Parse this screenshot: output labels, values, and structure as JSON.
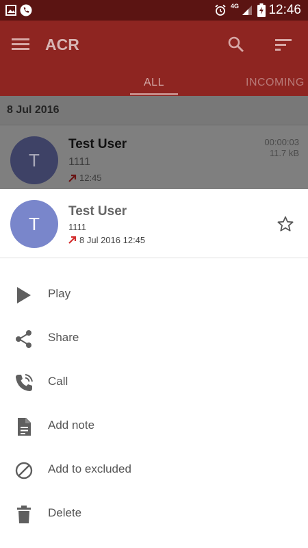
{
  "status_bar": {
    "time": "12:46",
    "network": "4G",
    "icons": [
      "gallery-icon",
      "phone-icon",
      "alarm-icon",
      "signal-icon",
      "battery-charging-icon"
    ]
  },
  "app_bar": {
    "title": "ACR",
    "tabs": [
      {
        "label": "ALL",
        "active": true
      },
      {
        "label": "INCOMING",
        "active": false
      }
    ]
  },
  "list": {
    "date_header": "8 Jul 2016",
    "item": {
      "avatar_letter": "T",
      "name": "Test User",
      "number": "1111",
      "time": "12:45",
      "duration": "00:00:03",
      "size": "11.7 kB"
    }
  },
  "sheet": {
    "avatar_letter": "T",
    "name": "Test User",
    "number": "1111",
    "datetime": "8 Jul 2016 12:45",
    "menu": [
      "Play",
      "Share",
      "Call",
      "Add note",
      "Add to excluded",
      "Delete"
    ]
  },
  "colors": {
    "status_bar": "#5b1412",
    "app_bar": "#8e2521",
    "avatar": "#7986cb",
    "outgoing_arrow": "#d32f2f"
  }
}
